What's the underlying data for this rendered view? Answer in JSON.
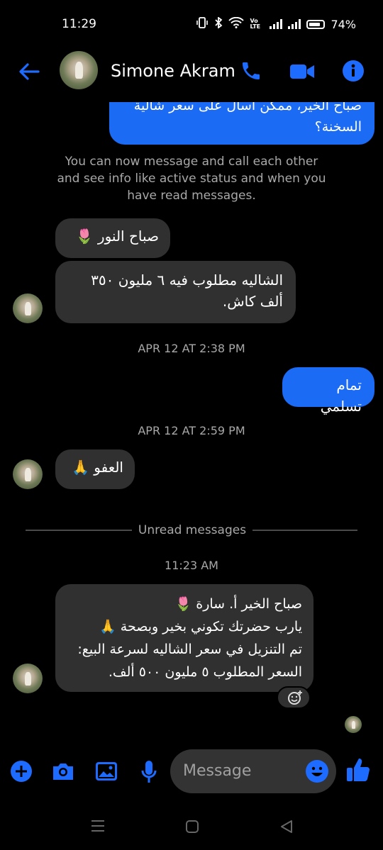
{
  "status_bar": {
    "time": "11:29",
    "network": "Vo LTE",
    "battery": "74%"
  },
  "header": {
    "contact_name": "Simone Akram"
  },
  "messages": {
    "partial_out": "صباح الخير، ممكن اسأل على سعر شالية السخنة؟",
    "system_notice": "You can now message and call each other and see info like active status and when you have read messages.",
    "in_1": "صباح النور 🌷",
    "in_2": "الشاليه مطلوب فيه ٦ مليون ٣٥٠ ألف كاش.",
    "timestamp_1": "APR 12 AT 2:38 PM",
    "out_1": "تمام تسلمي",
    "timestamp_2": "APR 12 AT 2:59 PM",
    "in_3": "العفو 🙏",
    "unread_label": "Unread messages",
    "timestamp_3": "11:23 AM",
    "in_4_line1": "صباح الخير أ. سارة 🌷",
    "in_4_line2": "يارب حضرتك تكوني بخير وبصحة 🙏",
    "in_4_line3": "تم التنزيل في سعر الشاليه لسرعة البيع:",
    "in_4_line4": "السعر المطلوب ٥ مليون ٥٠٠ ألف."
  },
  "composer": {
    "placeholder": "Message"
  },
  "icons": [
    "back-arrow-icon",
    "phone-icon",
    "video-icon",
    "info-icon",
    "plus-icon",
    "camera-icon",
    "image-icon",
    "mic-icon",
    "emoji-icon",
    "thumbs-up-icon",
    "add-reaction-icon",
    "recents-icon",
    "home-icon",
    "back-icon"
  ],
  "colors": {
    "accent": "#1b6bf5",
    "incoming_bubble": "#303030",
    "background": "#000000"
  }
}
